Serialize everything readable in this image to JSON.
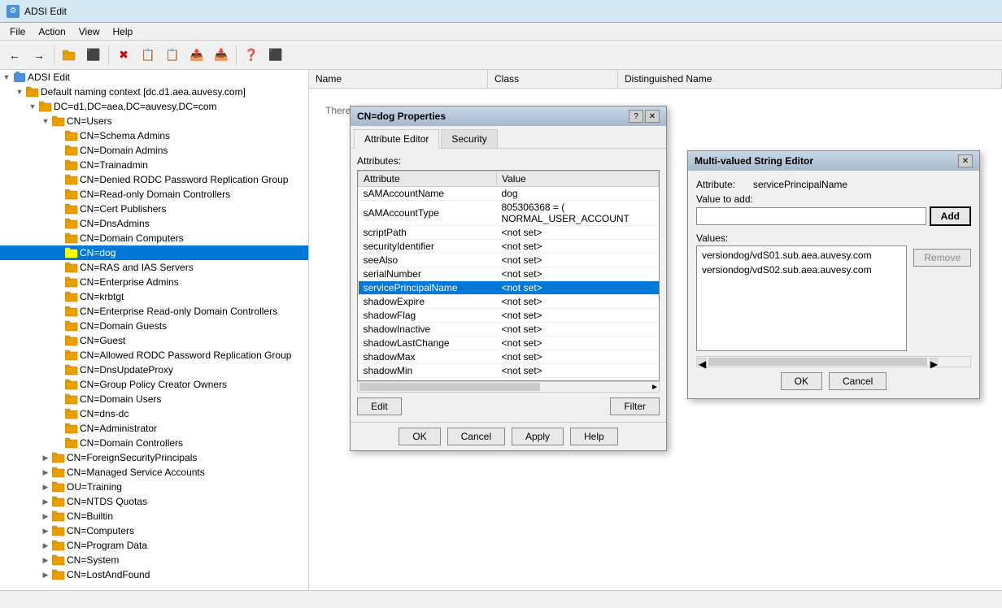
{
  "app": {
    "title": "ADSI Edit",
    "icon": "⚙"
  },
  "menu": {
    "items": [
      "File",
      "Action",
      "View",
      "Help"
    ]
  },
  "toolbar": {
    "buttons": [
      "←",
      "→",
      "📁",
      "⬛",
      "✖",
      "📋",
      "📋",
      "📤",
      "📥",
      "❓",
      "⬛"
    ]
  },
  "tree": {
    "header": "ADSI Edit",
    "nodes": [
      {
        "id": "adsi-root",
        "label": "ADSI Edit",
        "level": 0,
        "expanded": true,
        "type": "root"
      },
      {
        "id": "default-naming",
        "label": "Default naming context [dc.d1.aea.auvesy.com]",
        "level": 1,
        "expanded": true,
        "type": "container"
      },
      {
        "id": "dc-d1",
        "label": "DC=d1,DC=aea,DC=auvesy,DC=com",
        "level": 2,
        "expanded": true,
        "type": "folder"
      },
      {
        "id": "cn-users",
        "label": "CN=Users",
        "level": 3,
        "expanded": true,
        "type": "folder"
      },
      {
        "id": "cn-schema-admins",
        "label": "CN=Schema Admins",
        "level": 4,
        "expanded": false,
        "type": "folder"
      },
      {
        "id": "cn-domain-admins",
        "label": "CN=Domain Admins",
        "level": 4,
        "expanded": false,
        "type": "folder"
      },
      {
        "id": "cn-trainadmin",
        "label": "CN=Trainadmin",
        "level": 4,
        "expanded": false,
        "type": "folder"
      },
      {
        "id": "cn-denied-rodc",
        "label": "CN=Denied RODC Password Replication Group",
        "level": 4,
        "expanded": false,
        "type": "folder"
      },
      {
        "id": "cn-readonly-dc",
        "label": "CN=Read-only Domain Controllers",
        "level": 4,
        "expanded": false,
        "type": "folder"
      },
      {
        "id": "cn-cert-publishers",
        "label": "CN=Cert Publishers",
        "level": 4,
        "expanded": false,
        "type": "folder"
      },
      {
        "id": "cn-dns-admins",
        "label": "CN=DnsAdmins",
        "level": 4,
        "expanded": false,
        "type": "folder"
      },
      {
        "id": "cn-domain-computers",
        "label": "CN=Domain Computers",
        "level": 4,
        "expanded": false,
        "type": "folder"
      },
      {
        "id": "cn-dog",
        "label": "CN=dog",
        "level": 4,
        "expanded": false,
        "type": "folder",
        "selected": true
      },
      {
        "id": "cn-ras-ias",
        "label": "CN=RAS and IAS Servers",
        "level": 4,
        "expanded": false,
        "type": "folder"
      },
      {
        "id": "cn-enterprise-admins",
        "label": "CN=Enterprise Admins",
        "level": 4,
        "expanded": false,
        "type": "folder"
      },
      {
        "id": "cn-krbtgt",
        "label": "CN=krbtgt",
        "level": 4,
        "expanded": false,
        "type": "folder"
      },
      {
        "id": "cn-enterprise-rodc",
        "label": "CN=Enterprise Read-only Domain Controllers",
        "level": 4,
        "expanded": false,
        "type": "folder"
      },
      {
        "id": "cn-domain-guests",
        "label": "CN=Domain Guests",
        "level": 4,
        "expanded": false,
        "type": "folder"
      },
      {
        "id": "cn-guest",
        "label": "CN=Guest",
        "level": 4,
        "expanded": false,
        "type": "folder"
      },
      {
        "id": "cn-allowed-rodc",
        "label": "CN=Allowed RODC Password Replication Group",
        "level": 4,
        "expanded": false,
        "type": "folder"
      },
      {
        "id": "cn-dns-update-proxy",
        "label": "CN=DnsUpdateProxy",
        "level": 4,
        "expanded": false,
        "type": "folder"
      },
      {
        "id": "cn-group-policy-owners",
        "label": "CN=Group Policy Creator Owners",
        "level": 4,
        "expanded": false,
        "type": "folder"
      },
      {
        "id": "cn-domain-users",
        "label": "CN=Domain Users",
        "level": 4,
        "expanded": false,
        "type": "folder"
      },
      {
        "id": "cn-dns-dc",
        "label": "CN=dns-dc",
        "level": 4,
        "expanded": false,
        "type": "folder"
      },
      {
        "id": "cn-administrator",
        "label": "CN=Administrator",
        "level": 4,
        "expanded": false,
        "type": "folder"
      },
      {
        "id": "cn-domain-controllers",
        "label": "CN=Domain Controllers",
        "level": 4,
        "expanded": false,
        "type": "folder"
      },
      {
        "id": "cn-foreign-security",
        "label": "CN=ForeignSecurityPrincipals",
        "level": 3,
        "expanded": false,
        "type": "folder"
      },
      {
        "id": "cn-managed-service",
        "label": "CN=Managed Service Accounts",
        "level": 3,
        "expanded": false,
        "type": "folder"
      },
      {
        "id": "ou-training",
        "label": "OU=Training",
        "level": 3,
        "expanded": false,
        "type": "folder"
      },
      {
        "id": "cn-ntds-quotas",
        "label": "CN=NTDS Quotas",
        "level": 3,
        "expanded": false,
        "type": "folder"
      },
      {
        "id": "cn-builtin",
        "label": "CN=Builtin",
        "level": 3,
        "expanded": false,
        "type": "folder"
      },
      {
        "id": "cn-computers",
        "label": "CN=Computers",
        "level": 3,
        "expanded": false,
        "type": "folder"
      },
      {
        "id": "cn-program-data",
        "label": "CN=Program Data",
        "level": 3,
        "expanded": false,
        "type": "folder"
      },
      {
        "id": "cn-system",
        "label": "CN=System",
        "level": 3,
        "expanded": false,
        "type": "folder"
      },
      {
        "id": "cn-lost-found",
        "label": "CN=LostAndFound",
        "level": 3,
        "expanded": false,
        "type": "folder"
      }
    ]
  },
  "right_panel": {
    "columns": [
      "Name",
      "Class",
      "Distinguished Name"
    ],
    "empty_message": "There are no items to show in this view."
  },
  "properties_dialog": {
    "title": "CN=dog Properties",
    "tabs": [
      "Attribute Editor",
      "Security"
    ],
    "active_tab": "Attribute Editor",
    "attributes_label": "Attributes:",
    "col_attribute": "Attribute",
    "col_value": "Value",
    "attributes": [
      {
        "name": "sAMAccountName",
        "value": "dog"
      },
      {
        "name": "sAMAccountType",
        "value": "805306368 = ( NORMAL_USER_ACCOUNT"
      },
      {
        "name": "scriptPath",
        "value": "<not set>"
      },
      {
        "name": "securityIdentifier",
        "value": "<not set>"
      },
      {
        "name": "seeAlso",
        "value": "<not set>"
      },
      {
        "name": "serialNumber",
        "value": "<not set>"
      },
      {
        "name": "servicePrincipalName",
        "value": "<not set>",
        "selected": true
      },
      {
        "name": "shadowExpire",
        "value": "<not set>"
      },
      {
        "name": "shadowFlag",
        "value": "<not set>"
      },
      {
        "name": "shadowInactive",
        "value": "<not set>"
      },
      {
        "name": "shadowLastChange",
        "value": "<not set>"
      },
      {
        "name": "shadowMax",
        "value": "<not set>"
      },
      {
        "name": "shadowMin",
        "value": "<not set>"
      }
    ],
    "buttons": {
      "edit": "Edit",
      "filter": "Filter",
      "ok": "OK",
      "cancel": "Cancel",
      "apply": "Apply",
      "help": "Help"
    }
  },
  "mv_editor": {
    "title": "Multi-valued String Editor",
    "attribute_label": "Attribute:",
    "attribute_value": "servicePrincipalName",
    "value_to_add_label": "Value to add:",
    "value_input": "",
    "add_button": "Add",
    "values_label": "Values:",
    "values_list": [
      "versiondog/vdS01.sub.aea.auvesy.com",
      "versiondog/vdS02.sub.aea.auvesy.com"
    ],
    "remove_button": "Remove",
    "ok_button": "OK",
    "cancel_button": "Cancel"
  },
  "colors": {
    "selection_bg": "#0078d7",
    "selection_text": "#ffffff",
    "dialog_title_bg": "#c8d8e8",
    "folder_icon": "#e8a000",
    "accent": "#0078d7"
  }
}
